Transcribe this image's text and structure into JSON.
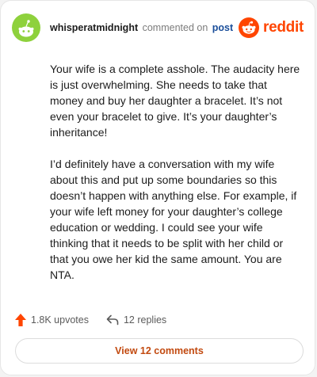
{
  "header": {
    "username": "whisperatmidnight",
    "action": "commented on",
    "target": "post",
    "brand": "reddit"
  },
  "comment": {
    "paragraphs": [
      "Your wife is a complete asshole. The audacity here is just overwhelming. She needs to take that money and buy her daughter a bracelet. It’s not even your bracelet to give. It’s your daughter’s inheritance!",
      "I’d definitely have a conversation with my wife about this and put up some boundaries so this doesn’t happen with anything else. For example, if your wife left money for your daughter’s college education or wedding. I could see your wife thinking that it needs to be split with her child or that you owe her kid the same amount. You are NTA."
    ]
  },
  "footer": {
    "upvotes": "1.8K upvotes",
    "replies": "12 replies",
    "view_comments": "View 12 comments"
  },
  "colors": {
    "accent": "#ff4500",
    "link": "#1a4e9a",
    "avatar_green": "#8ed13c"
  },
  "icons": [
    "avatar-icon",
    "reddit-logo-icon",
    "upvote-arrow-icon",
    "reply-arrow-icon"
  ]
}
